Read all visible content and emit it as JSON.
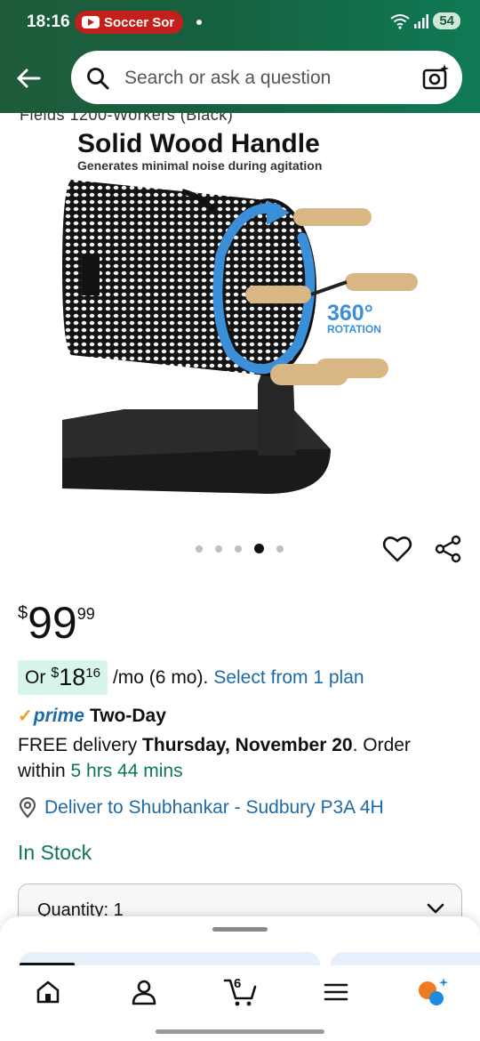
{
  "status_bar": {
    "time": "18:16",
    "notification": "Soccer Sor",
    "battery": "54"
  },
  "header": {
    "search_placeholder": "Search or ask a question"
  },
  "product_image": {
    "cut_off_title": "Fields 1200-Workers (Black)",
    "title": "Solid Wood Handle",
    "subtitle": "Generates minimal noise during agitation",
    "rotation_value": "360°",
    "rotation_label": "ROTATION"
  },
  "carousel": {
    "total": 5,
    "active_index": 3
  },
  "price": {
    "symbol": "$",
    "whole": "99",
    "fraction": "99"
  },
  "installment": {
    "prefix": "Or",
    "symbol": "$",
    "whole": "18",
    "fraction": "16",
    "term": "/mo (6 mo).",
    "link": "Select from 1 plan"
  },
  "prime": {
    "check": "✓",
    "word": "prime",
    "speed": "Two-Day"
  },
  "delivery": {
    "prefix": "FREE delivery ",
    "date": "Thursday, November 20",
    "middle": ". Order within ",
    "countdown": "5 hrs 44 mins"
  },
  "location": {
    "text": "Deliver to Shubhankar - Sudbury P3A 4H"
  },
  "stock": {
    "status": "In Stock"
  },
  "quantity": {
    "label": "Quantity: 1"
  },
  "nav": {
    "cart_count": "6"
  },
  "colors": {
    "header_green": "#1e5b3a",
    "link_blue": "#1f6aa5",
    "success_green": "#0b7a53",
    "installment_bg": "#d8f5e9",
    "rotation_blue": "#3b8fd9",
    "prime_orange": "#f29a1e"
  }
}
